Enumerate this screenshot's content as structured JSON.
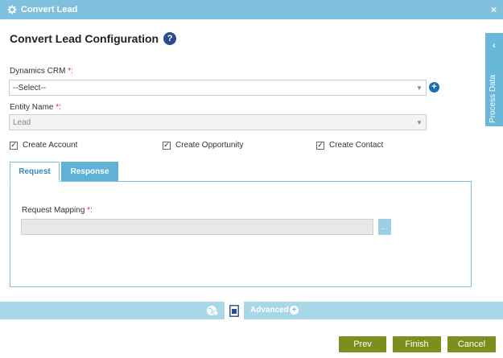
{
  "window": {
    "title": "Convert Lead",
    "close_symbol": "×"
  },
  "heading": "Convert Lead Configuration",
  "help_symbol": "?",
  "dynamics_crm": {
    "label": "Dynamics CRM",
    "required_mark": "*:",
    "value": "--Select--"
  },
  "entity_name": {
    "label": "Entity Name",
    "required_mark": "*:",
    "value": "Lead"
  },
  "checkboxes": [
    {
      "label": "Create Account",
      "checked": true
    },
    {
      "label": "Create Opportunity",
      "checked": true
    },
    {
      "label": "Create Contact",
      "checked": true
    }
  ],
  "tabs": [
    {
      "label": "Request",
      "active": true
    },
    {
      "label": "Response",
      "active": false
    }
  ],
  "request_mapping": {
    "label": "Request Mapping",
    "required_mark": "*:",
    "value": "",
    "browse_label": "..."
  },
  "side_panel": {
    "label": "Process Data",
    "chevron": "‹"
  },
  "advanced": {
    "label": "Advanced",
    "plus": "+"
  },
  "buttons": {
    "prev": "Prev",
    "finish": "Finish",
    "cancel": "Cancel"
  },
  "colors": {
    "header": "#7ec0de",
    "tab_active_text": "#3a8ab8",
    "button": "#7a8f1e",
    "required": "#d9302a",
    "help": "#2b4c8c"
  }
}
